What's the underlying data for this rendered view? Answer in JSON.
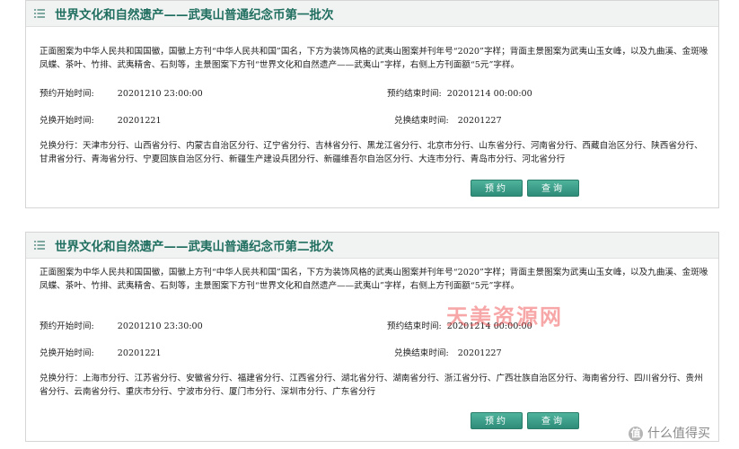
{
  "batches": [
    {
      "title": "世界文化和自然遗产——武夷山普通纪念币第一批次",
      "description": "正面图案为中华人民共和国国徽，国徽上方刊“中华人民共和国”国名，下方为装饰风格的武夷山图案并刊年号“2020”字样；背面主景图案为武夷山玉女峰，以及九曲溪、金斑喙凤蝶、茶叶、竹排、武夷精舍、石刻等，主景图案下方刊“世界文化和自然遗产——武夷山”字样，右侧上方刊面额“5元”字样。",
      "reserve_start_label": "预约开始时间:",
      "reserve_start_value": "20201210 23:00:00",
      "reserve_end_label": "预约结束时间:",
      "reserve_end_value": "20201214 00:00:00",
      "exchange_start_label": "兑换开始时间:",
      "exchange_start_value": "20201221",
      "exchange_end_label": "兑换结束时间:",
      "exchange_end_value": "20201227",
      "branches": "兑换分行：天津市分行、山西省分行、内蒙古自治区分行、辽宁省分行、吉林省分行、黑龙江省分行、北京市分行、山东省分行、河南省分行、西藏自治区分行、陕西省分行、甘肃省分行、青海省分行、宁夏回族自治区分行、新疆生产建设兵团分行、新疆维吾尔自治区分行、大连市分行、青岛市分行、河北省分行",
      "reserve_button": "预约",
      "query_button": "查询"
    },
    {
      "title": "世界文化和自然遗产——武夷山普通纪念币第二批次",
      "description": "正面图案为中华人民共和国国徽，国徽上方刊“中华人民共和国”国名，下方为装饰风格的武夷山图案并刊年号“2020”字样；背面主景图案为武夷山玉女峰，以及九曲溪、金斑喙凤蝶、茶叶、竹排、武夷精舍、石刻等，主景图案下方刊“世界文化和自然遗产——武夷山”字样，右侧上方刊面额“5元”字样。",
      "reserve_start_label": "预约开始时间:",
      "reserve_start_value": "20201210 23:30:00",
      "reserve_end_label": "预约结束时间:",
      "reserve_end_value": "20201214 00:00:00",
      "exchange_start_label": "兑换开始时间:",
      "exchange_start_value": "20201221",
      "exchange_end_label": "兑换结束时间:",
      "exchange_end_value": "20201227",
      "branches": "兑换分行：上海市分行、江苏省分行、安徽省分行、福建省分行、江西省分行、湖北省分行、湖南省分行、浙江省分行、广西壮族自治区分行、海南省分行、四川省分行、贵州省分行、云南省分行、重庆市分行、宁波市分行、厦门市分行、深圳市分行、广东省分行",
      "reserve_button": "预约",
      "query_button": "查询"
    }
  ],
  "watermark": "天美资源网",
  "corner_logo": "什么值得买",
  "corner_logo_glyph": "值",
  "colors": {
    "title": "#1f6e5f",
    "button": "#3a9e88",
    "header_bg": "#f1f3f2"
  },
  "icons": [
    "list-icon"
  ]
}
